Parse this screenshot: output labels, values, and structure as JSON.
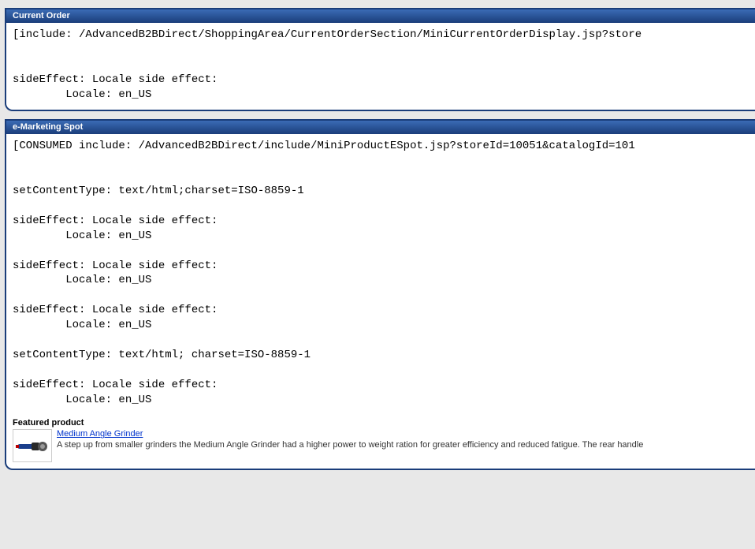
{
  "panels": {
    "current_order": {
      "title": "Current Order",
      "include_line": "[include: /AdvancedB2BDirect/ShoppingArea/CurrentOrderSection/MiniCurrentOrderDisplay.jsp?store",
      "side_effect_label": "sideEffect: Locale side effect:",
      "locale_line": "        Locale: en_US"
    },
    "espot": {
      "title": "e-Marketing Spot",
      "consumed_line": "[CONSUMED include: /AdvancedB2BDirect/include/MiniProductESpot.jsp?storeId=10051&catalogId=101",
      "set_content_type_1": "setContentType: text/html;charset=ISO-8859-1",
      "side_effect_1": "sideEffect: Locale side effect:",
      "locale_1": "        Locale: en_US",
      "side_effect_2": "sideEffect: Locale side effect:",
      "locale_2": "        Locale: en_US",
      "side_effect_3": "sideEffect: Locale side effect:",
      "locale_3": "        Locale: en_US",
      "set_content_type_2": "setContentType: text/html; charset=ISO-8859-1",
      "side_effect_4": "sideEffect: Locale side effect:",
      "locale_4": "        Locale: en_US"
    }
  },
  "featured": {
    "heading": "Featured product",
    "link_text": "Medium Angle Grinder",
    "description": "A step up from smaller grinders the Medium Angle Grinder had a higher power to weight ration for greater efficiency and reduced fatigue. The rear handle"
  }
}
